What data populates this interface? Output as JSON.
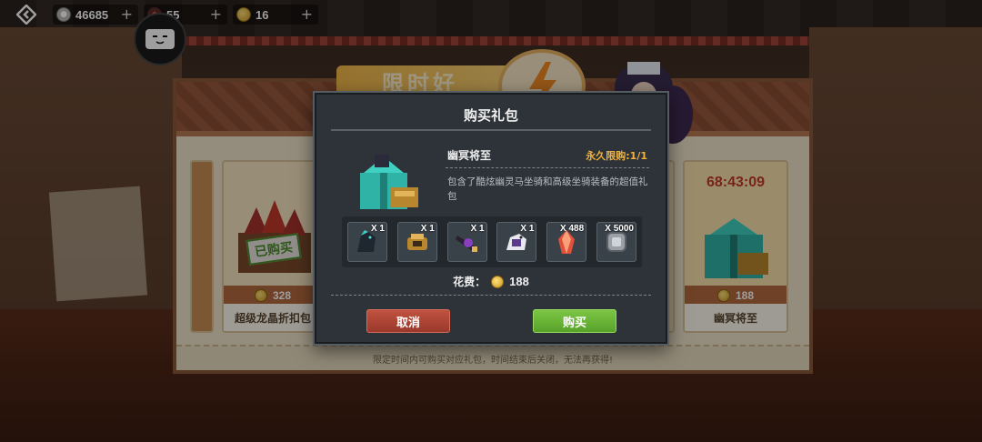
{
  "topbar": {
    "currencies": [
      {
        "icon": "silver-coin-icon",
        "value": "46685",
        "plus": "+"
      },
      {
        "icon": "red-gem-icon",
        "value": "55",
        "plus": "+"
      },
      {
        "icon": "gold-coin-icon",
        "value": "16",
        "plus": "+"
      }
    ]
  },
  "board": {
    "banner_text": "限时好",
    "footer_notice": "限定时间内可购买对应礼包，时间结束后关闭，无法再获得!",
    "cards": [
      {
        "stamp": "已购买",
        "price": "328",
        "name": "超级龙晶折扣包"
      },
      {
        "timer": "68:43:09",
        "price": "188",
        "name": "幽冥将至"
      }
    ]
  },
  "modal": {
    "title": "购买礼包",
    "package_name": "幽冥将至",
    "limit": "永久限购:1/1",
    "description": "包含了酷炫幽灵马坐骑和高级坐骑装备的超值礼包",
    "items": [
      {
        "icon": "ghost-horse-icon",
        "qty": "X 1"
      },
      {
        "icon": "saddle-icon",
        "qty": "X 1"
      },
      {
        "icon": "armor-icon",
        "qty": "X 1"
      },
      {
        "icon": "horse-gear-icon",
        "qty": "X 1"
      },
      {
        "icon": "crystal-icon",
        "qty": "X 488"
      },
      {
        "icon": "silver-coin-icon",
        "qty": "X 5000"
      }
    ],
    "cost_label": "花费：",
    "cost_value": "188",
    "cancel_label": "取消",
    "buy_label": "购买"
  },
  "colors": {
    "modal_bg": "#2d3338",
    "limit_text": "#f0b13c",
    "cancel_btn": "#b04634",
    "buy_btn": "#6bb53a",
    "timer_text": "#c0392b"
  }
}
